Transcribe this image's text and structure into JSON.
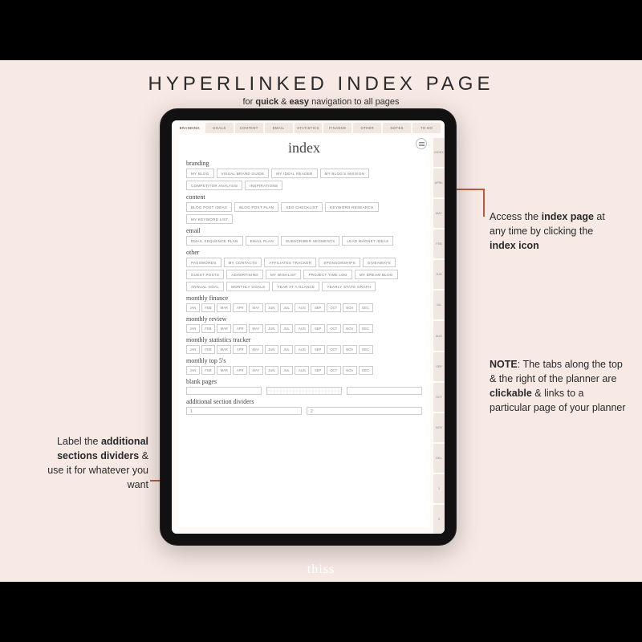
{
  "header": {
    "title": "HYPERLINKED INDEX PAGE",
    "subtitle_pre": "for ",
    "subtitle_b1": "quick",
    "subtitle_mid": " & ",
    "subtitle_b2": "easy",
    "subtitle_post": " navigation to all pages"
  },
  "brand": "thiss",
  "callouts": {
    "right1_a": "Access the ",
    "right1_b": "index page",
    "right1_c": " at any time by clicking the ",
    "right1_d": "index icon",
    "right2_note": "NOTE",
    "right2_a": ": The tabs along the top & the right of the planner are ",
    "right2_b": "clickable",
    "right2_c": " & links to a particular page of your planner",
    "left_a": "Label the ",
    "left_b": "additional sections dividers",
    "left_c": " & use it for whatever you want"
  },
  "planner": {
    "page_title": "index",
    "top_tabs": [
      "BRANDING",
      "GOALS",
      "CONTENT",
      "EMAIL",
      "STATISTICS",
      "FINANCE",
      "OTHER",
      "NOTES",
      "TO DO"
    ],
    "side_tabs": [
      "INDEX",
      "APRIL",
      "MAY",
      "FEB",
      "JUN",
      "JUL",
      "AUG",
      "SEP",
      "OCT",
      "NOV",
      "DEC",
      "1",
      "2"
    ],
    "sections": {
      "branding": {
        "heading": "branding",
        "items": [
          "MY BLOG",
          "VISUAL BRAND GUIDE",
          "MY IDEAL READER",
          "MY BLOG'S MISSION",
          "COMPETITOR ANALYSIS",
          "INSPIRATIONS"
        ]
      },
      "content": {
        "heading": "content",
        "items": [
          "BLOG POST IDEAS",
          "BLOG POST PLAN",
          "SEO CHECKLIST",
          "KEYWORD RESEARCH",
          "MY KEYWORD LIST"
        ]
      },
      "email": {
        "heading": "email",
        "items": [
          "EMAIL SEQUENCE PLAN",
          "EMAIL PLAN",
          "SUBSCRIBER SEGMENTS",
          "LEAD MAGNET IDEAS"
        ]
      },
      "other": {
        "heading": "other",
        "items": [
          "PASSWORDS",
          "MY CONTACTS",
          "AFFILIATES TRACKER",
          "SPONSORSHIPS",
          "GIVEAWAYS",
          "GUEST POSTS",
          "ADVERTISING",
          "MY WISHLIST",
          "PROJECT TIME LOG",
          "MY DREAM BLOG",
          "ANNUAL GOAL",
          "MONTHLY GOALS",
          "YEAR AT A GLANCE",
          "YEARLY STATS GRAPH"
        ]
      }
    },
    "monthly_headings": [
      "monthly finance",
      "monthly review",
      "monthly statistics tracker",
      "monthly top 5's"
    ],
    "months": [
      "JAN",
      "FEB",
      "MAR",
      "APR",
      "MAY",
      "JUN",
      "JUL",
      "AUG",
      "SEP",
      "OCT",
      "NOV",
      "DEC"
    ],
    "blank_heading": "blank pages",
    "dividers_heading": "additional section dividers",
    "divider_labels": [
      "1",
      "2"
    ]
  }
}
